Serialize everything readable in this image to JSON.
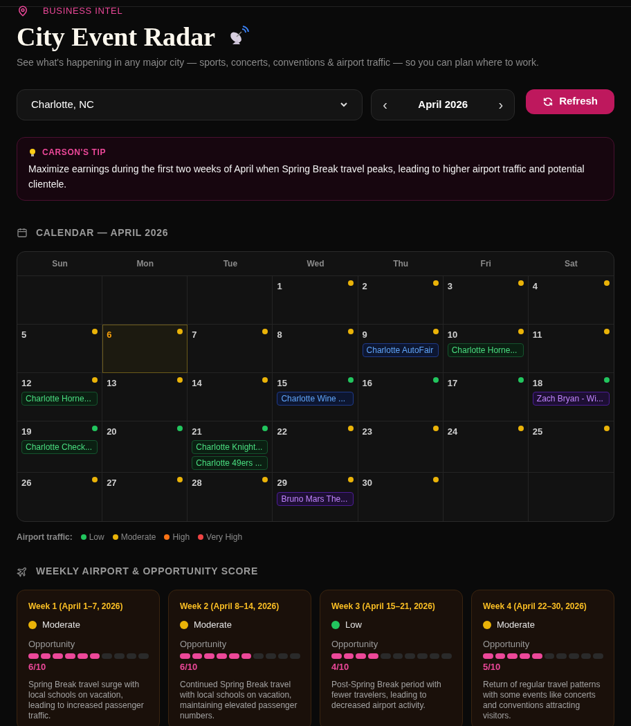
{
  "header": {
    "eyebrow": "BUSINESS INTEL",
    "title": "City Event Radar",
    "subtitle": "See what's happening in any major city — sports, concerts, conventions & airport traffic — so you can plan where to work."
  },
  "controls": {
    "city": "Charlotte, NC",
    "prev": "‹",
    "month": "April 2026",
    "next": "›",
    "refresh": "Refresh"
  },
  "tip": {
    "label": "CARSON'S TIP",
    "text": "Maximize earnings during the first two weeks of April when Spring Break travel peaks, leading to higher airport traffic and potential clientele."
  },
  "calendar": {
    "heading": "CALENDAR — APRIL 2026",
    "weekdays": [
      "Sun",
      "Mon",
      "Tue",
      "Wed",
      "Thu",
      "Fri",
      "Sat"
    ],
    "days": [
      {
        "day": "1",
        "color": "#eab308",
        "selected": false
      },
      {
        "day": "2",
        "color": "#eab308",
        "selected": false
      },
      {
        "day": "3",
        "color": "#eab308",
        "selected": false
      },
      {
        "day": "4",
        "color": "#eab308",
        "selected": false
      },
      {
        "day": "5",
        "color": "#eab308",
        "selected": false
      },
      {
        "day": "6",
        "color": "#eab308",
        "selected": true
      },
      {
        "day": "7",
        "color": "#eab308",
        "selected": false
      },
      {
        "day": "8",
        "color": "#eab308",
        "selected": false
      },
      {
        "day": "9",
        "color": "#eab308",
        "selected": false,
        "events": [
          {
            "title": "Charlotte AutoFair",
            "kind": "convention"
          }
        ]
      },
      {
        "day": "10",
        "color": "#eab308",
        "selected": false,
        "events": [
          {
            "title": "Charlotte Horne...",
            "kind": "sports"
          }
        ]
      },
      {
        "day": "11",
        "color": "#eab308",
        "selected": false
      },
      {
        "day": "12",
        "color": "#eab308",
        "selected": false,
        "events": [
          {
            "title": "Charlotte Horne...",
            "kind": "sports"
          }
        ]
      },
      {
        "day": "13",
        "color": "#eab308",
        "selected": false
      },
      {
        "day": "14",
        "color": "#eab308",
        "selected": false
      },
      {
        "day": "15",
        "color": "#22c55e",
        "selected": false,
        "events": [
          {
            "title": "Charlotte Wine ...",
            "kind": "convention"
          }
        ]
      },
      {
        "day": "16",
        "color": "#22c55e",
        "selected": false
      },
      {
        "day": "17",
        "color": "#22c55e",
        "selected": false
      },
      {
        "day": "18",
        "color": "#22c55e",
        "selected": false,
        "events": [
          {
            "title": "Zach Bryan - Wi...",
            "kind": "concert"
          }
        ]
      },
      {
        "day": "19",
        "color": "#22c55e",
        "selected": false,
        "events": [
          {
            "title": "Charlotte Check...",
            "kind": "sports"
          }
        ]
      },
      {
        "day": "20",
        "color": "#22c55e",
        "selected": false
      },
      {
        "day": "21",
        "color": "#22c55e",
        "selected": false,
        "events": [
          {
            "title": "Charlotte Knight...",
            "kind": "sports"
          },
          {
            "title": "Charlotte 49ers ...",
            "kind": "sports"
          }
        ]
      },
      {
        "day": "22",
        "color": "#eab308",
        "selected": false
      },
      {
        "day": "23",
        "color": "#eab308",
        "selected": false
      },
      {
        "day": "24",
        "color": "#eab308",
        "selected": false
      },
      {
        "day": "25",
        "color": "#eab308",
        "selected": false
      },
      {
        "day": "26",
        "color": "#eab308",
        "selected": false
      },
      {
        "day": "27",
        "color": "#eab308",
        "selected": false
      },
      {
        "day": "28",
        "color": "#eab308",
        "selected": false
      },
      {
        "day": "29",
        "color": "#eab308",
        "selected": false,
        "events": [
          {
            "title": "Bruno Mars The...",
            "kind": "concert"
          }
        ]
      },
      {
        "day": "30",
        "color": "#eab308",
        "selected": false
      }
    ]
  },
  "legend": {
    "label": "Airport traffic:",
    "items": [
      {
        "label": "Low",
        "color": "#22c55e"
      },
      {
        "label": "Moderate",
        "color": "#eab308"
      },
      {
        "label": "High",
        "color": "#f97316"
      },
      {
        "label": "Very High",
        "color": "#ef4444"
      }
    ]
  },
  "weekly": {
    "heading": "WEEKLY AIRPORT & OPPORTUNITY SCORE",
    "weeks": [
      {
        "title": "Week 1 (April 1–7, 2026)",
        "traffic": "Moderate",
        "color": "#eab308",
        "opportunity_label": "Opportunity",
        "level": 0.6,
        "score": "6/10",
        "note": "Spring Break travel surge with local schools on vacation, leading to increased passenger traffic."
      },
      {
        "title": "Week 2 (April 8–14, 2026)",
        "traffic": "Moderate",
        "color": "#eab308",
        "opportunity_label": "Opportunity",
        "level": 0.6,
        "score": "6/10",
        "note": "Continued Spring Break travel with local schools on vacation, maintaining elevated passenger numbers."
      },
      {
        "title": "Week 3 (April 15–21, 2026)",
        "traffic": "Low",
        "color": "#22c55e",
        "opportunity_label": "Opportunity",
        "level": 0.4,
        "score": "4/10",
        "note": "Post-Spring Break period with fewer travelers, leading to decreased airport activity."
      },
      {
        "title": "Week 4 (April 22–30, 2026)",
        "traffic": "Moderate",
        "color": "#eab308",
        "opportunity_label": "Opportunity",
        "level": 0.5,
        "score": "5/10",
        "note": "Return of regular travel patterns with some events like concerts and conventions attracting visitors."
      }
    ]
  }
}
